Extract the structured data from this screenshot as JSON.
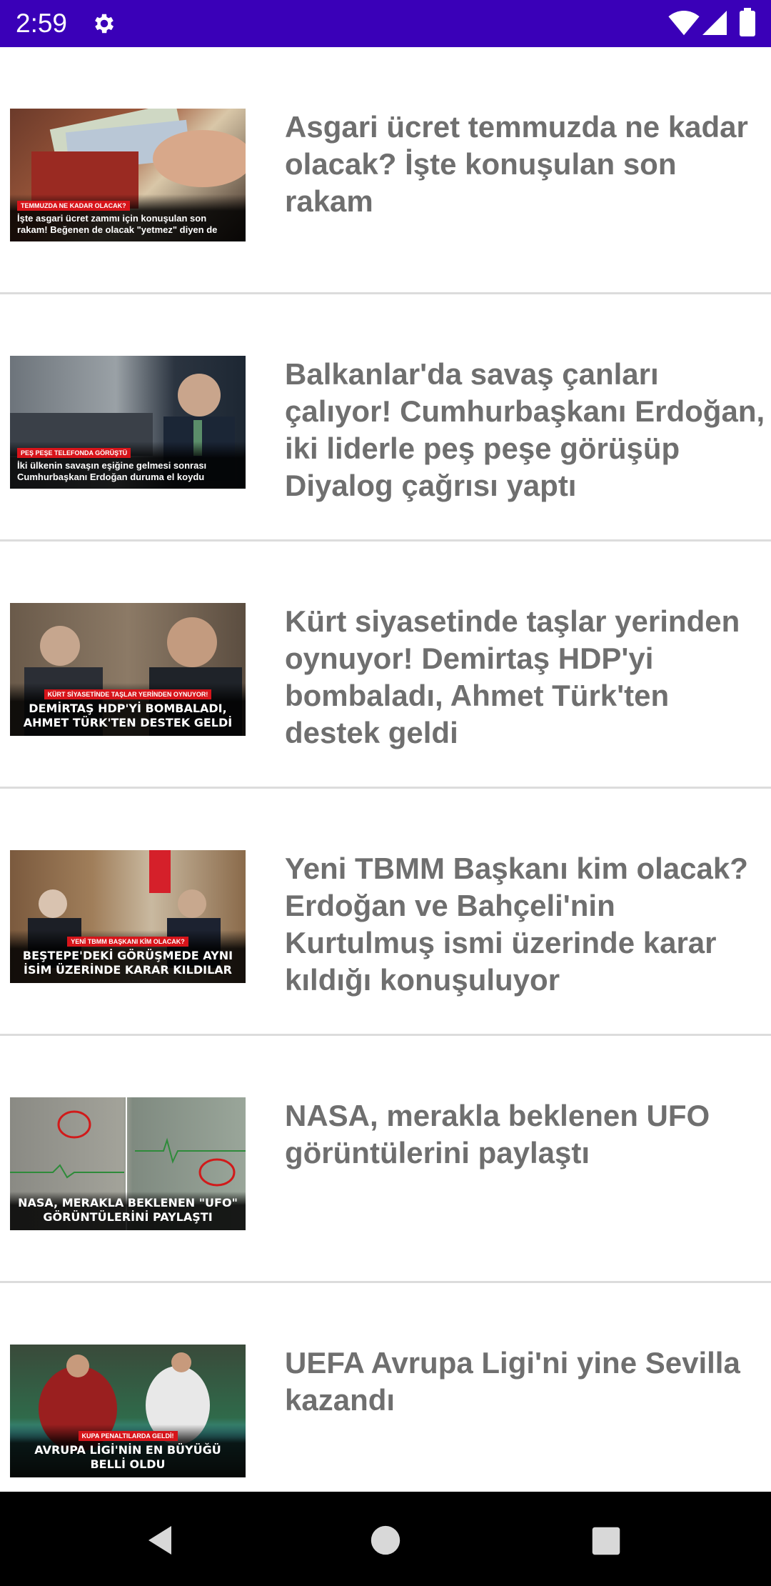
{
  "status_bar": {
    "time": "2:59",
    "background_color": "#3a00b8",
    "icons": [
      "gear-icon",
      "wifi-icon",
      "signal-icon",
      "battery-icon"
    ]
  },
  "news": [
    {
      "headline": "Asgari ücret temmuzda ne kadar olacak? İşte konuşulan son rakam",
      "thumb_tag": "TEMMUZDA NE KADAR OLACAK?",
      "thumb_text": "İşte asgari ücret zammı için konuşulan son rakam! Beğenen de olacak \"yetmez\" diyen de"
    },
    {
      "headline": "Balkanlar'da savaş çanları çalıyor! Cumhurbaşkanı Erdoğan, iki liderle peş peşe görüşüp Diyalog çağrısı yaptı",
      "thumb_tag": "PEŞ PEŞE TELEFONDA GÖRÜŞTÜ",
      "thumb_text": "İki ülkenin savaşın eşiğine gelmesi sonrası Cumhurbaşkanı Erdoğan duruma el koydu"
    },
    {
      "headline": "Kürt siyasetinde taşlar yerinden oynuyor! Demirtaş HDP'yi bombaladı, Ahmet Türk'ten destek geldi",
      "thumb_tag": "KÜRT SİYASETİNDE TAŞLAR YERİNDEN OYNUYOR!",
      "thumb_text": "DEMİRTAŞ HDP'Yİ BOMBALADI, AHMET TÜRK'TEN DESTEK GELDİ"
    },
    {
      "headline": "Yeni TBMM Başkanı kim olacak? Erdoğan ve Bahçeli'nin Kurtulmuş ismi üzerinde karar kıldığı konuşuluyor",
      "thumb_tag": "YENİ TBMM BAŞKANI KİM OLACAK?",
      "thumb_text": "BEŞTEPE'DEKİ GÖRÜŞMEDE AYNI İSİM ÜZERİNDE KARAR KILDILAR"
    },
    {
      "headline": "NASA, merakla beklenen UFO görüntülerini paylaştı",
      "thumb_tag": "",
      "thumb_text": "NASA, MERAKLA BEKLENEN \"UFO\" GÖRÜNTÜLERİNİ PAYLAŞTI"
    },
    {
      "headline": "UEFA Avrupa Ligi'ni yine Sevilla kazandı",
      "thumb_tag": "KUPA PENALTILARDA GELDİ!",
      "thumb_text": "AVRUPA LİGİ'NİN EN BÜYÜĞÜ BELLİ OLDU"
    }
  ],
  "nav_bar": {
    "icons": [
      "back-icon",
      "home-icon",
      "recents-icon"
    ]
  }
}
